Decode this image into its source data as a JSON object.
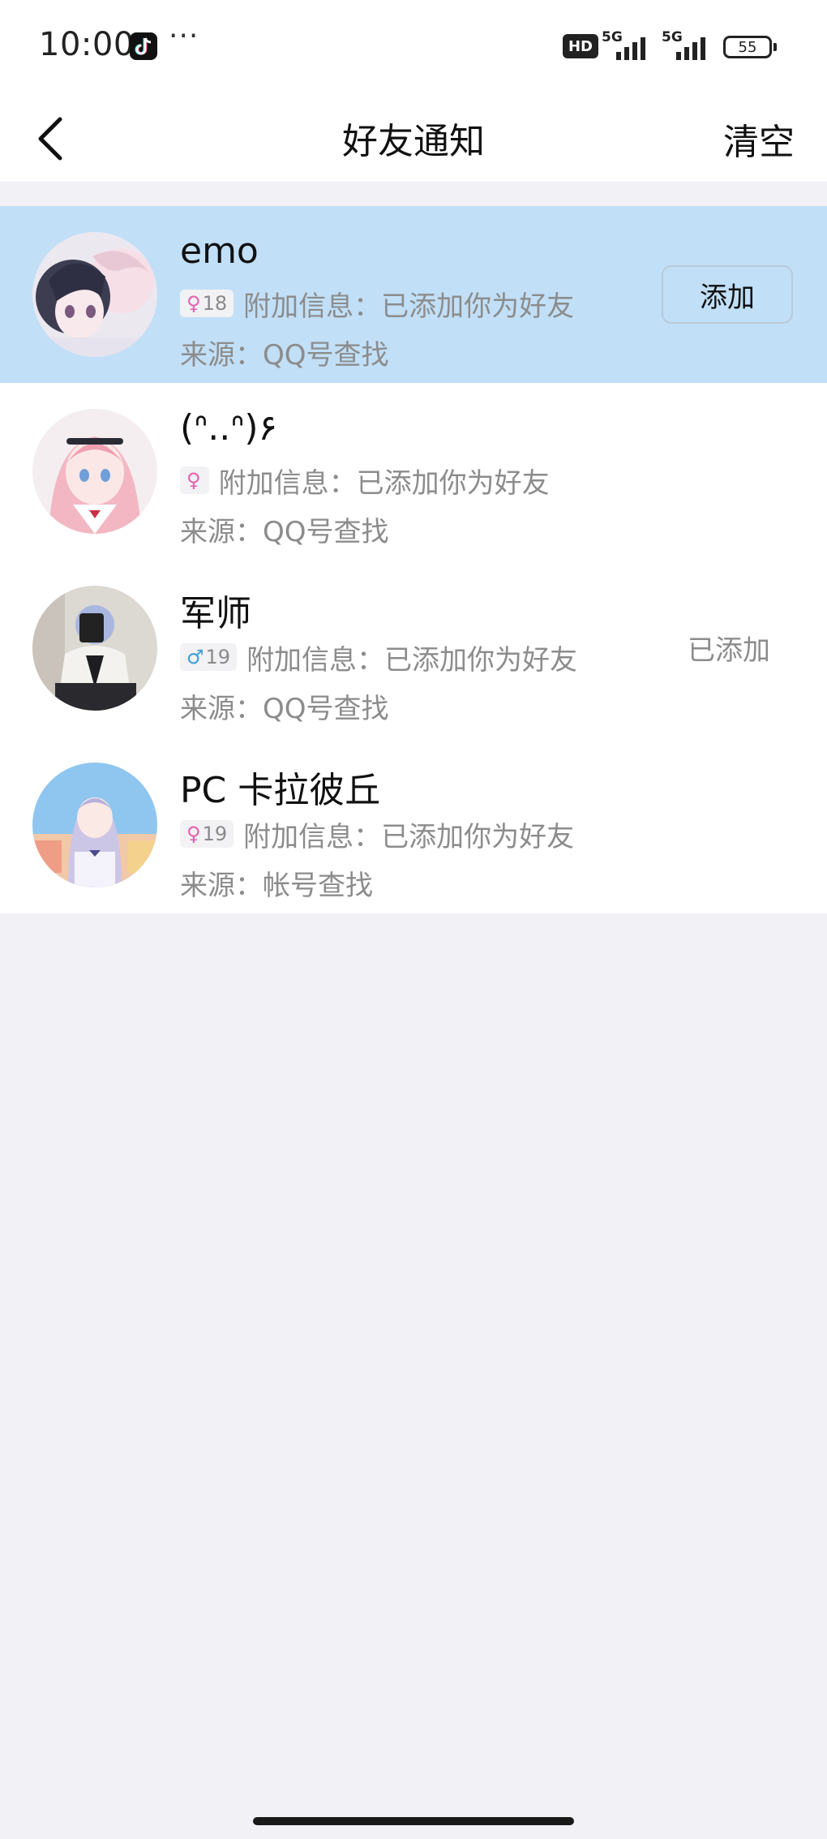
{
  "status_bar": {
    "time": "10:00",
    "dots": "···",
    "hd": "HD",
    "network_1": "5G",
    "network_2": "5G",
    "battery": "55"
  },
  "header": {
    "title": "好友通知",
    "clear_label": "清空",
    "back_icon": "chevron-left-icon"
  },
  "requests": [
    {
      "name": "emo",
      "gender": "female",
      "gender_symbol": "♀",
      "age": "18",
      "info_text": "附加信息：已添加你为好友",
      "source_text": "来源：QQ号查找",
      "action_label": "添加",
      "highlighted": true
    },
    {
      "name": "(ᐢ..ᐢ)۶",
      "gender": "female",
      "gender_symbol": "♀",
      "age": "",
      "info_text": "附加信息：已添加你为好友",
      "source_text": "来源：QQ号查找",
      "highlighted": false
    },
    {
      "name": "军师",
      "gender": "male",
      "gender_symbol": "♂",
      "age": "19",
      "info_text": "附加信息：已添加你为好友",
      "source_text": "来源：QQ号查找",
      "status_label": "已添加",
      "highlighted": false
    },
    {
      "name": "PC 卡拉彼丘",
      "gender": "female",
      "gender_symbol": "♀",
      "age": "19",
      "info_text": "附加信息：已添加你为好友",
      "source_text": "来源：帐号查找",
      "highlighted": false
    }
  ],
  "colors": {
    "highlight_row": "#c1dff7",
    "page_background": "#f1f1f6",
    "secondary_text": "#8c8c8c",
    "female": "#e65fae",
    "male": "#3a9ed9"
  }
}
